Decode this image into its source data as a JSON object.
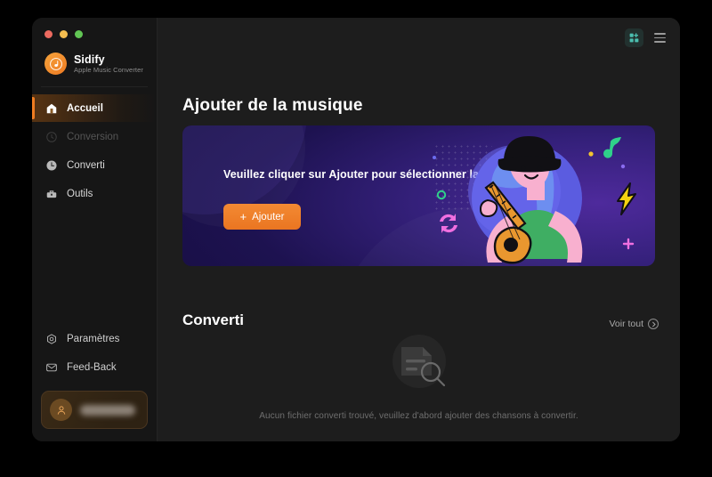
{
  "window": {
    "traffic_lights": [
      "close",
      "minimize",
      "zoom"
    ],
    "colors": {
      "accent_orange": "#ea7521",
      "sidebar_bg": "#161616",
      "main_bg": "#1d1d1d",
      "banner_purple": "#1d1250",
      "grid_icon_teal": "#4bbfb0"
    }
  },
  "sidebar": {
    "brand": {
      "title": "Sidify",
      "subtitle": "Apple Music Converter",
      "logo_icon": "sidify-note-logo"
    },
    "items": [
      {
        "label": "Accueil",
        "icon": "home-icon",
        "active": true,
        "disabled": false
      },
      {
        "label": "Conversion",
        "icon": "refresh-icon",
        "active": false,
        "disabled": true
      },
      {
        "label": "Converti",
        "icon": "clock-icon",
        "active": false,
        "disabled": false
      },
      {
        "label": "Outils",
        "icon": "toolbox-icon",
        "active": false,
        "disabled": false
      }
    ],
    "bottom_items": [
      {
        "label": "Paramètres",
        "icon": "gear-icon"
      },
      {
        "label": "Feed-Back",
        "icon": "envelope-icon"
      }
    ],
    "account": {
      "icon": "user-icon",
      "name": ""
    }
  },
  "topbar": {
    "grid_icon": "apps-add-grid-icon",
    "menu_icon": "hamburger-menu-icon"
  },
  "main": {
    "page_title": "Ajouter de la musique",
    "banner": {
      "message": "Veuillez cliquer sur Ajouter pour sélectionner la musique",
      "add_button_label": "Ajouter",
      "add_button_plus": "+",
      "illustration": "guitarist-illustration"
    },
    "converted_section": {
      "title": "Converti",
      "see_all_label": "Voir tout",
      "see_all_icon": "chevron-right-circle-icon",
      "empty_icon": "document-search-icon",
      "empty_message": "Aucun fichier converti trouvé, veuillez d'abord ajouter des chansons à convertir."
    }
  }
}
